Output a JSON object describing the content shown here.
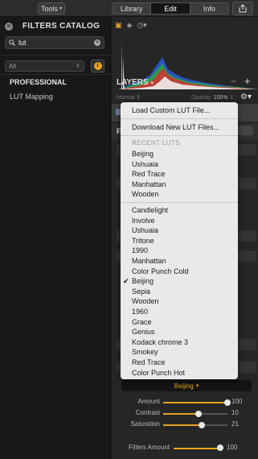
{
  "topbar": {
    "tools_label": "Tools",
    "tabs": [
      {
        "label": "Library",
        "active": false
      },
      {
        "label": "Edit",
        "active": true
      },
      {
        "label": "Info",
        "active": false
      }
    ]
  },
  "catalog": {
    "title": "FILTERS CATALOG",
    "search_value": "lut",
    "filter_select": "All",
    "group_title": "PROFESSIONAL",
    "group_item": "LUT Mapping"
  },
  "layers": {
    "title": "LAYERS",
    "blend_mode": "Normal",
    "opacity_label": "Opacity:",
    "opacity_value": "100%"
  },
  "lut": {
    "selected": "Beijing",
    "sliders": [
      {
        "label": "Amount",
        "value": 100,
        "fraction": 1.0
      },
      {
        "label": "Contrast",
        "value": 10,
        "fraction": 0.55
      },
      {
        "label": "Saturation",
        "value": 21,
        "fraction": 0.6
      }
    ],
    "filters_amount_label": "Filters Amount",
    "filters_amount_value": 100
  },
  "menu": {
    "load": "Load Custom LUT File...",
    "download": "Download New LUT Files...",
    "recent_header": "RECENT LUTS",
    "recent": [
      "Beijing",
      "Ushuaia",
      "Red Trace",
      "Manhattan",
      "Wooden"
    ],
    "all": [
      "Candlelight",
      "Involve",
      "Ushuaia",
      "Tritone",
      "1990",
      "Manhattan",
      "Color Punch Cold",
      "Beijing",
      "Sepia",
      "Wooden",
      "1960",
      "Grace",
      "Genius",
      "Kodack chrome  3",
      "Smokey",
      "Red Trace",
      "Color Punch Hot"
    ],
    "checked_item": "Beijing"
  },
  "colors": {
    "accent": "#e7a321",
    "menu_bg": "#e9e9e9"
  }
}
